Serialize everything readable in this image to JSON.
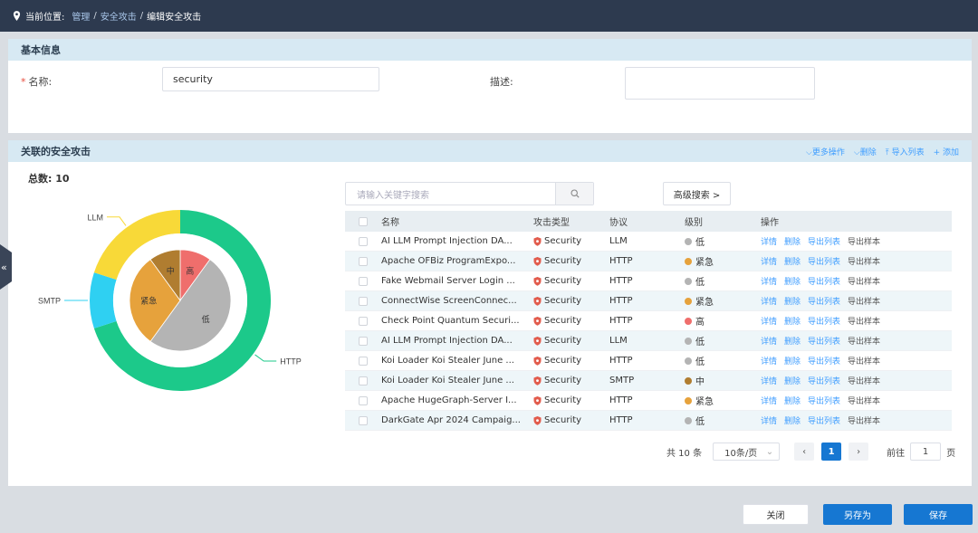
{
  "breadcrumb": {
    "label": "当前位置:",
    "items": [
      "管理",
      "安全攻击",
      "编辑安全攻击"
    ],
    "separator": "/"
  },
  "basic": {
    "title": "基本信息",
    "name_label": "名称:",
    "name_value": "security",
    "desc_label": "描述:",
    "desc_value": ""
  },
  "attacks": {
    "title": "关联的安全攻击",
    "actions": [
      "更多操作",
      "删除",
      "导入列表",
      "添加"
    ],
    "total_label": "总数: 10"
  },
  "chart_data": {
    "type": "pie",
    "outer": {
      "name": "协议",
      "slices": [
        {
          "label": "HTTP",
          "value": 7,
          "color": "#1cc98a"
        },
        {
          "label": "SMTP",
          "value": 1,
          "color": "#2fd0f2"
        },
        {
          "label": "LLM",
          "value": 2,
          "color": "#f8d938"
        }
      ]
    },
    "inner": {
      "name": "级别",
      "slices": [
        {
          "label": "高",
          "value": 1,
          "color": "#ef6e6c"
        },
        {
          "label": "低",
          "value": 5,
          "color": "#b4b4b4"
        },
        {
          "label": "紧急",
          "value": 3,
          "color": "#e6a23c"
        },
        {
          "label": "中",
          "value": 1,
          "color": "#b07d30"
        }
      ]
    }
  },
  "search": {
    "placeholder": "请输入关键字搜索",
    "advanced_label": "高级搜索 >"
  },
  "table": {
    "columns": [
      "名称",
      "攻击类型",
      "协议",
      "级别",
      "操作"
    ],
    "ops": [
      "详情",
      "删除",
      "导出列表",
      "导出样本"
    ],
    "rows": [
      {
        "name": "AI LLM Prompt Injection DA...",
        "type": "Security",
        "proto": "LLM",
        "level": "低",
        "level_color": "#b4b4b4"
      },
      {
        "name": "Apache OFBiz ProgramExpo...",
        "type": "Security",
        "proto": "HTTP",
        "level": "紧急",
        "level_color": "#e6a23c"
      },
      {
        "name": "Fake Webmail Server Login ...",
        "type": "Security",
        "proto": "HTTP",
        "level": "低",
        "level_color": "#b4b4b4"
      },
      {
        "name": "ConnectWise ScreenConnec...",
        "type": "Security",
        "proto": "HTTP",
        "level": "紧急",
        "level_color": "#e6a23c"
      },
      {
        "name": "Check Point Quantum Securi...",
        "type": "Security",
        "proto": "HTTP",
        "level": "高",
        "level_color": "#ef6e6c"
      },
      {
        "name": "AI LLM Prompt Injection DA...",
        "type": "Security",
        "proto": "LLM",
        "level": "低",
        "level_color": "#b4b4b4"
      },
      {
        "name": "Koi Loader Koi Stealer June ...",
        "type": "Security",
        "proto": "HTTP",
        "level": "低",
        "level_color": "#b4b4b4"
      },
      {
        "name": "Koi Loader Koi Stealer June ...",
        "type": "Security",
        "proto": "SMTP",
        "level": "中",
        "level_color": "#b07d30"
      },
      {
        "name": "Apache HugeGraph-Server I...",
        "type": "Security",
        "proto": "HTTP",
        "level": "紧急",
        "level_color": "#e6a23c"
      },
      {
        "name": "DarkGate Apr 2024 Campaig...",
        "type": "Security",
        "proto": "HTTP",
        "level": "低",
        "level_color": "#b4b4b4"
      }
    ]
  },
  "pagination": {
    "total": "共 10 条",
    "page_size": "10条/页",
    "current": "1",
    "goto_label": "前往",
    "goto_value": "1",
    "page_suffix": "页"
  },
  "footer": {
    "close": "关闭",
    "save_as": "另存为",
    "save": "保存"
  },
  "sidebar_toggle": "«"
}
